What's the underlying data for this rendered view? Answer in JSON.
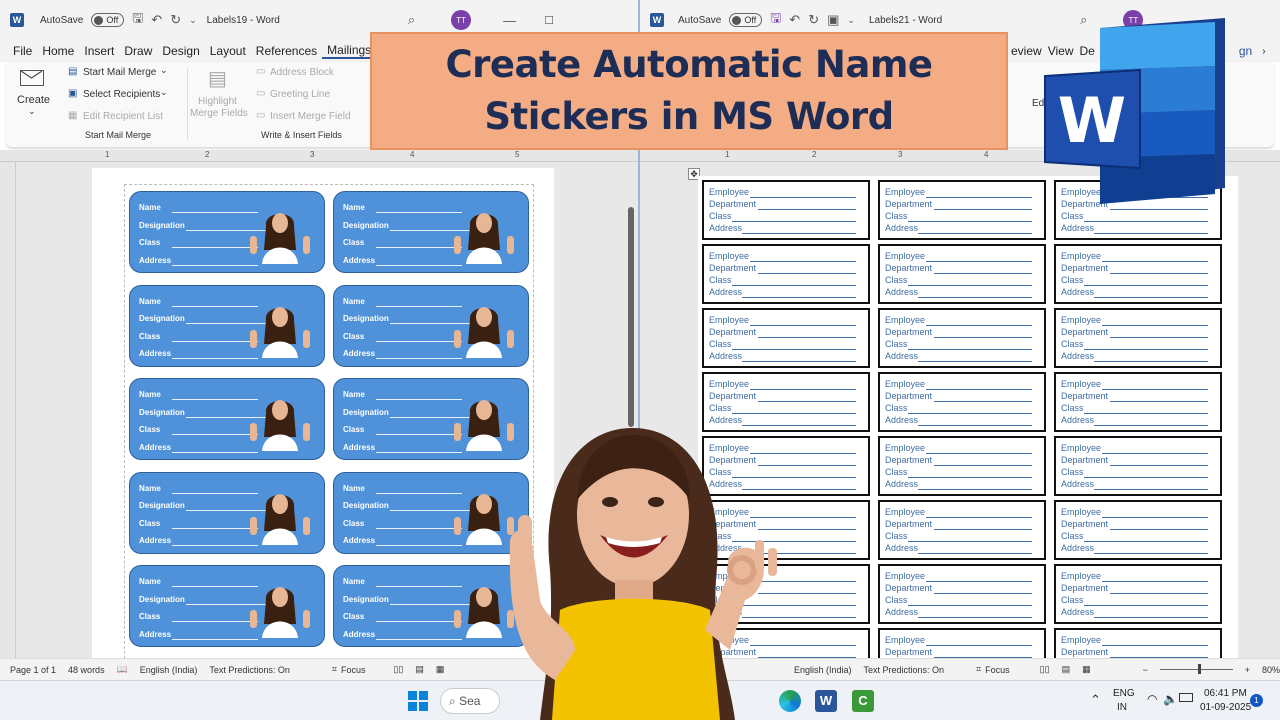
{
  "left_window": {
    "autosave_label": "AutoSave",
    "autosave_state": "Off",
    "doc_title": "Labels19 - Word",
    "avatar": "TT",
    "menu": [
      "File",
      "Home",
      "Insert",
      "Draw",
      "Design",
      "Layout",
      "References",
      "Mailings",
      "R"
    ],
    "active_menu": "Mailings",
    "ribbon": {
      "create": "Create",
      "start_mail_merge": "Start Mail Merge",
      "select_recipients": "Select Recipients",
      "edit_recipient_list": "Edit Recipient List",
      "group_start": "Start Mail Merge",
      "highlight_merge_fields_1": "Highlight",
      "highlight_merge_fields_2": "Merge Fields",
      "address_block": "Address Block",
      "greeting_line": "Greeting Line",
      "insert_merge_field": "Insert Merge Field",
      "group_write": "Write & Insert Fields"
    },
    "label_fields": [
      "Name",
      "Designation",
      "Class",
      "Address"
    ],
    "status": {
      "page": "Page 1 of 1",
      "words": "48 words",
      "language": "English (India)",
      "predictions": "Text Predictions: On",
      "focus": "Focus"
    }
  },
  "right_window": {
    "autosave_label": "AutoSave",
    "autosave_state": "Off",
    "doc_title": "Labels21 - Word",
    "avatar": "TT",
    "menu_partial": [
      "eview",
      "View",
      "De"
    ],
    "sign_partial": "gn",
    "ribbon_partial": "Ed",
    "label_fields": [
      "Employee",
      "Department",
      "Class",
      "Address"
    ],
    "partial_label": "Emplo",
    "status": {
      "language": "English (India)",
      "predictions": "Text Predictions: On",
      "focus": "Focus",
      "zoom": "80%"
    }
  },
  "banner": {
    "line1": "Create Automatic Name",
    "line2": "Stickers in MS Word"
  },
  "ruler_numbers_left": [
    "1",
    "2",
    "3",
    "4",
    "5"
  ],
  "ruler_numbers_right": [
    "1",
    "2",
    "3",
    "4",
    "5"
  ],
  "vruler_numbers": [
    "1",
    "2",
    "3",
    "4",
    "5",
    "6",
    "7",
    "8"
  ],
  "taskbar": {
    "search_text": "Sea",
    "lang_1": "ENG",
    "lang_2": "IN",
    "time": "06:41 PM",
    "date": "01-09-2025",
    "notifications": "1"
  },
  "colors": {
    "label_blue": "#4f92d9",
    "word_blue": "#2b579a",
    "banner_orange": "#f4ac84",
    "banner_text": "#1e2d55"
  }
}
